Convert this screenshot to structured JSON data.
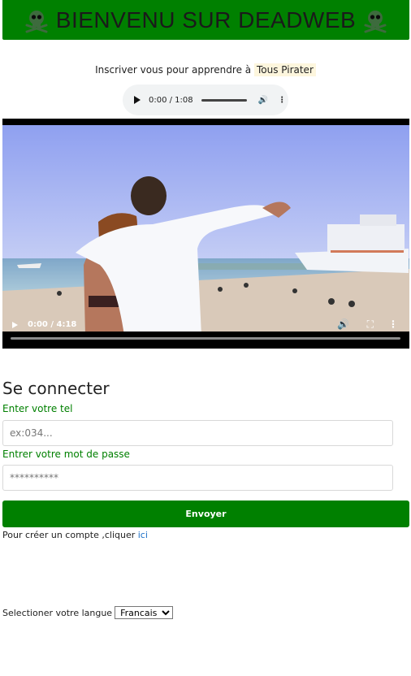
{
  "header": {
    "title": "BIENVENU SUR DEADWEB",
    "left_icon": "skull-crossbones-icon",
    "right_icon": "skull-crossbones-icon",
    "background": "#008000"
  },
  "tagline": {
    "text": "Inscriver vous pour apprendre à",
    "highlight": "Tous Pirater"
  },
  "audio_player": {
    "time": "0:00 / 1:08"
  },
  "video_player": {
    "time": "0:00 / 4:18"
  },
  "login": {
    "title": "Se connecter",
    "phone_label": "Enter votre tel",
    "phone_placeholder": "ex:034...",
    "password_label": "Entrer votre mot de passe",
    "password_placeholder": "**********",
    "submit_label": "Envoyer",
    "signup_text": "Pour créer un compte ,cliquer",
    "signup_link": "ici"
  },
  "language": {
    "label": "Selectioner votre langue",
    "selected": "Francais"
  },
  "colors": {
    "accent": "#008000",
    "link": "#1a6fc7"
  }
}
